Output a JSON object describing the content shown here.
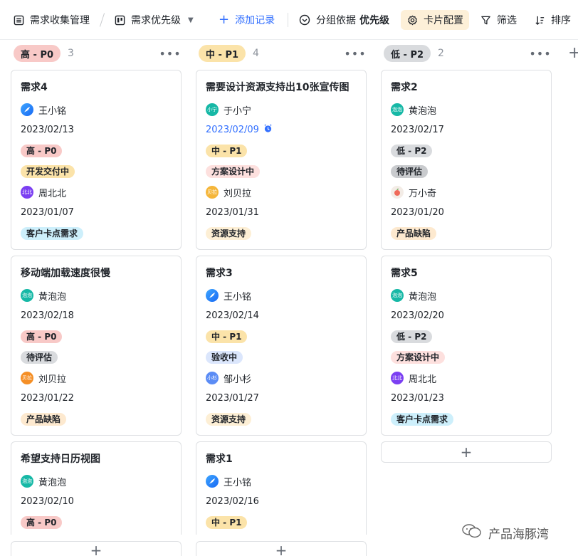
{
  "toolbar": {
    "table_name": "需求收集管理",
    "view_name": "需求优先级",
    "add_record": "添加记录",
    "group_by_label": "分组依据",
    "group_by_value": "优先级",
    "card_config": "卡片配置",
    "filter": "筛选",
    "sort": "排序"
  },
  "columns": [
    {
      "label": "高 - P0",
      "count": "3",
      "color": "#f8c9c7",
      "cards": [
        {
          "title": "需求4",
          "person": "王小铭",
          "avatar": "feather",
          "date1": "2023/02/13",
          "priority": "高 - P0",
          "status": "开发交付中",
          "status_color": "#fbe3a9",
          "person2": "周北北",
          "avatar2": "北北",
          "avatar2_color": "#7b3ff2",
          "date2": "2023/01/07",
          "type": "客户卡点需求",
          "type_color": "#cdeffb"
        },
        {
          "title": "移动端加载速度很慢",
          "person": "黄泡泡",
          "avatar": "泡泡",
          "date1": "2023/02/18",
          "priority": "高 - P0",
          "status": "待评估",
          "status_color": "#d9dbde",
          "person2": "刘贝拉",
          "avatar2": "贝拉",
          "avatar2_color": "#f58f26",
          "date2": "2023/01/22",
          "type": "产品缺陷",
          "type_color": "#fde9cf"
        },
        {
          "title": "希望支持日历视图",
          "person": "黄泡泡",
          "avatar": "泡泡",
          "date1": "2023/02/10",
          "priority": "高 - P0"
        }
      ]
    },
    {
      "label": "中 - P1",
      "count": "4",
      "color": "#fbe3a9",
      "cards": [
        {
          "title": "需要设计资源支持出10张宣传图",
          "person": "于小宁",
          "avatar": "小宁",
          "date1": "2023/02/09",
          "date1_blue": true,
          "priority": "中 - P1",
          "status": "方案设计中",
          "status_color": "#fde0de",
          "person2": "刘贝拉",
          "avatar2": "贝拉",
          "avatar2_color": "#f5b63a",
          "date2": "2023/01/31",
          "type": "资源支持",
          "type_color": "#fdefd5"
        },
        {
          "title": "需求3",
          "person": "王小铭",
          "avatar": "feather",
          "date1": "2023/02/14",
          "priority": "中 - P1",
          "status": "验收中",
          "status_color": "#dbe6fc",
          "person2": "邹小杉",
          "avatar2": "小杉",
          "avatar2_color": "#5b8cf5",
          "date2": "2023/01/27",
          "type": "资源支持",
          "type_color": "#fdefd5"
        },
        {
          "title": "需求1",
          "person": "王小铭",
          "avatar": "feather",
          "date1": "2023/02/16",
          "priority": "中 - P1"
        }
      ]
    },
    {
      "label": "低 - P2",
      "count": "2",
      "color": "#d9dbde",
      "cards": [
        {
          "title": "需求2",
          "person": "黄泡泡",
          "avatar": "泡泡",
          "date1": "2023/02/17",
          "priority": "低 - P2",
          "status": "待评估",
          "status_color": "#c9cbce",
          "person2": "万小奇",
          "avatar2": "apple",
          "avatar2_color": "#f3ece6",
          "date2": "2023/01/20",
          "type": "产品缺陷",
          "type_color": "#fde9cf"
        },
        {
          "title": "需求5",
          "person": "黄泡泡",
          "avatar": "泡泡",
          "date1": "2023/02/20",
          "priority": "低 - P2",
          "status": "方案设计中",
          "status_color": "#fde0de",
          "person2": "周北北",
          "avatar2": "北北",
          "avatar2_color": "#7b3ff2",
          "date2": "2023/01/23",
          "type": "客户卡点需求",
          "type_color": "#cdeffb"
        }
      ]
    }
  ],
  "watermark": "产品海豚湾"
}
